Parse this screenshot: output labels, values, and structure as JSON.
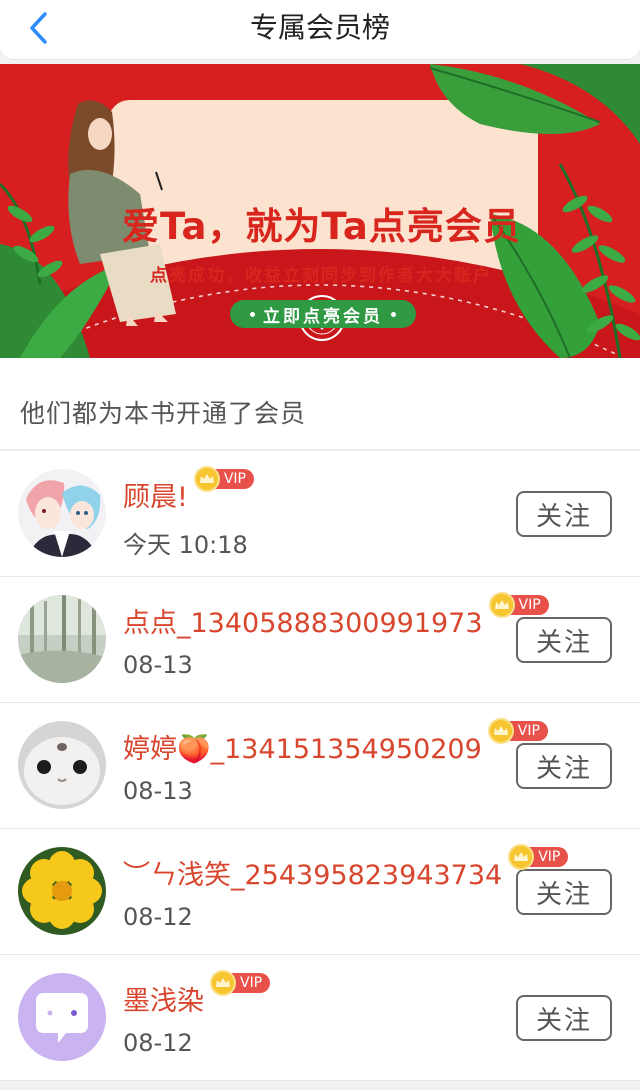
{
  "header": {
    "title": "专属会员榜",
    "back_icon": "chevron-left-icon",
    "accent_color": "#2f8cff"
  },
  "banner": {
    "title": "爱Ta，就为Ta点亮会员",
    "subtitle": "点亮成功，收益立刻同步到作者大大账户",
    "cta_label": "立即点亮会员",
    "colors": {
      "background": "#d81f1f",
      "card": "#fbe3cf",
      "text": "#d8261f",
      "cta": "#2f9944"
    }
  },
  "section": {
    "title": "他们都为本书开通了会员"
  },
  "vip_label": "VIP",
  "follow_label": "关注",
  "members": [
    {
      "name": "顾晨!",
      "time": "今天 10:18",
      "avatar": "anime-couple-avatar"
    },
    {
      "name": "点点_13405888300991973",
      "time": "08-13",
      "avatar": "forest-photo-avatar"
    },
    {
      "name": "婷婷🍑_134151354950209",
      "time": "08-13",
      "avatar": "cat-photo-avatar"
    },
    {
      "name": "︶ㄣ浅笑_254395823943734",
      "time": "08-12",
      "avatar": "yellow-flower-avatar"
    },
    {
      "name": "墨浅染",
      "time": "08-12",
      "avatar": "chat-bubble-avatar"
    }
  ]
}
